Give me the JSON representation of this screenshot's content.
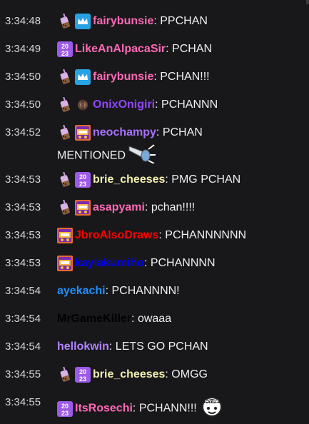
{
  "messages": [
    {
      "time": "3:34:48",
      "badges": [
        "boba",
        "crown"
      ],
      "user": "fairybunsie",
      "color": "#ff69b4",
      "text": "PPCHAN"
    },
    {
      "time": "3:34:49",
      "badges": [
        "num"
      ],
      "user": "LikeAnAlpacaSir",
      "color": "#ff69b4",
      "text": "PCHAN"
    },
    {
      "time": "3:34:50",
      "badges": [
        "boba",
        "crown"
      ],
      "user": "fairybunsie",
      "color": "#ff69b4",
      "text": "PCHAN!!!"
    },
    {
      "time": "3:34:50",
      "badges": [
        "boba",
        "choco"
      ],
      "user": "OnixOnigiri",
      "color": "#9146ff",
      "text": "PCHANNN"
    },
    {
      "time": "3:34:52",
      "badges": [
        "boba",
        "tv"
      ],
      "user": "neochampy",
      "color": "#a970ff",
      "text": "PCHAN",
      "text2": "MENTIONED",
      "emote": "megaphone-emote"
    },
    {
      "time": "3:34:53",
      "badges": [
        "boba",
        "num"
      ],
      "user": "brie_cheeses",
      "color": "#f4f0b0",
      "text": "PMG PCHAN"
    },
    {
      "time": "3:34:53",
      "badges": [
        "boba",
        "tv"
      ],
      "user": "asapyami",
      "color": "#ff69b4",
      "text": "pchan!!!!"
    },
    {
      "time": "3:34:53",
      "badges": [
        "tv"
      ],
      "user": "JbroAlsoDraws",
      "color": "#ff0000",
      "text": "PCHANNNNNN"
    },
    {
      "time": "3:34:53",
      "badges": [
        "tv"
      ],
      "user": "kaylakumiho",
      "color": "#0000ff",
      "text": "PCHANNNN"
    },
    {
      "time": "3:34:54",
      "badges": [],
      "user": "ayekachi",
      "color": "#1e90ff",
      "text": "PCHANNNN!"
    },
    {
      "time": "3:34:54",
      "badges": [],
      "user": "MrGameKiller",
      "color": "#000000",
      "text": "owaaa"
    },
    {
      "time": "3:34:54",
      "badges": [],
      "user": "hellokwin",
      "color": "#b283ff",
      "text": "LETS GO PCHAN"
    },
    {
      "time": "3:34:55",
      "badges": [
        "boba",
        "num"
      ],
      "user": "brie_cheeses",
      "color": "#f4f0b0",
      "text": "OMGG"
    },
    {
      "time": "3:34:55",
      "badges": [
        "num"
      ],
      "user": "ItsRosechi",
      "color": "#ff69b4",
      "text": "PCHANN!!!",
      "emote": "hype-emote"
    }
  ]
}
